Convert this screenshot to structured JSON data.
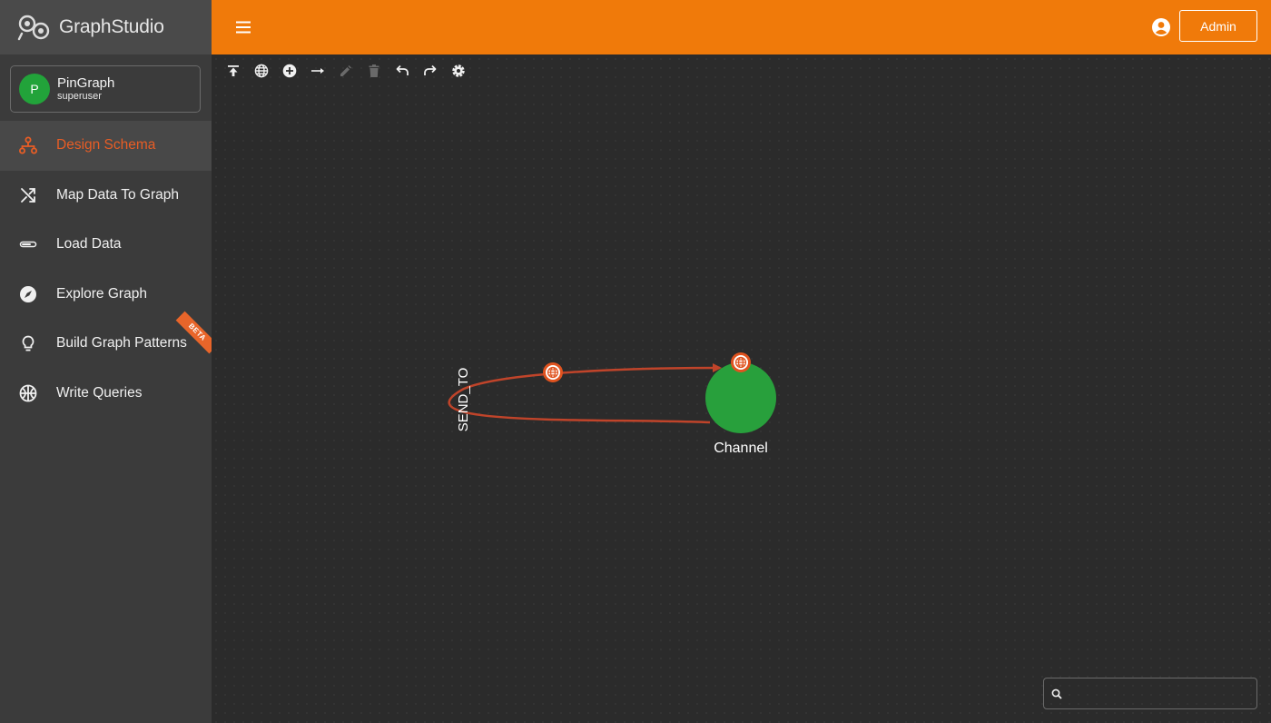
{
  "app": {
    "brand": "GraphStudio"
  },
  "header": {
    "user_button": "Admin"
  },
  "graph": {
    "avatar_letter": "P",
    "name": "PinGraph",
    "role": "superuser"
  },
  "sidebar": {
    "items": [
      {
        "label": "Design Schema",
        "icon": "schema-icon",
        "active": true
      },
      {
        "label": "Map Data To Graph",
        "icon": "shuffle-icon"
      },
      {
        "label": "Load Data",
        "icon": "progress-bar-icon"
      },
      {
        "label": "Explore Graph",
        "icon": "compass-icon"
      },
      {
        "label": "Build Graph Patterns",
        "icon": "lightbulb-icon",
        "badge": "BETA"
      },
      {
        "label": "Write Queries",
        "icon": "globe-grid-icon"
      }
    ]
  },
  "toolbar": {
    "tools": [
      "publish-icon",
      "globe-icon",
      "add-vertex-icon",
      "add-edge-icon",
      "edit-icon",
      "delete-icon",
      "undo-icon",
      "redo-icon",
      "settings-icon"
    ]
  },
  "schema": {
    "vertex": {
      "label": "Channel",
      "color": "#28a03c"
    },
    "edge": {
      "label": "SEND_TO",
      "color": "#c0442a"
    }
  },
  "search": {
    "placeholder": ""
  },
  "colors": {
    "accent": "#f07a0a",
    "active": "#e85d25",
    "sidebar": "#3b3b3b",
    "canvas": "#2b2b2b"
  }
}
